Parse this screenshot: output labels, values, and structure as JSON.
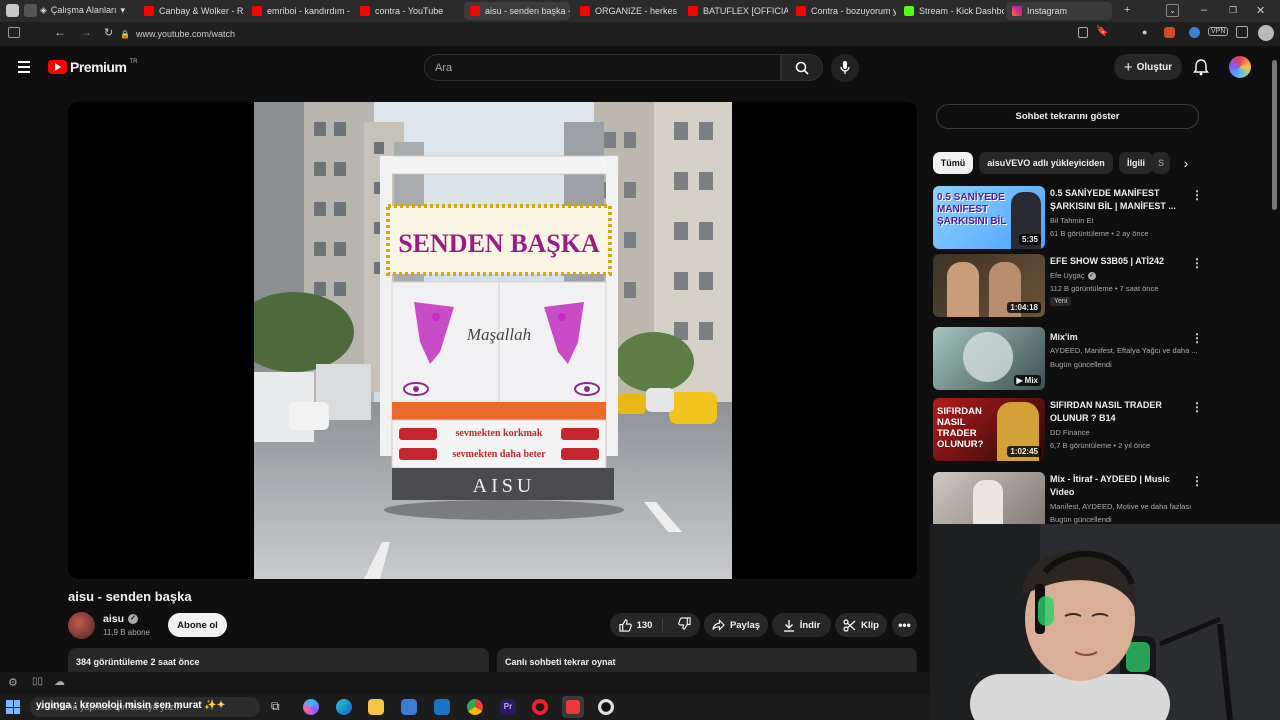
{
  "browser": {
    "workspaces_label": "Çalışma Alanları",
    "tabs": [
      {
        "title": "Canbay & Wolker - Rüs",
        "favicon": "youtube-icon"
      },
      {
        "title": "emriboi - kandırdım - Yo",
        "favicon": "youtube-icon"
      },
      {
        "title": "contra - YouTube",
        "favicon": "youtube-icon"
      },
      {
        "title": "aisu - senden başka - Yo",
        "favicon": "youtube-icon"
      },
      {
        "title": "ORGANIZE - herkes ken",
        "favicon": "youtube-icon"
      },
      {
        "title": "BATUFLEX [OFFICIAL VI",
        "favicon": "youtube-icon"
      },
      {
        "title": "Contra - bozuyorum ye",
        "favicon": "youtube-icon"
      },
      {
        "title": "Stream - Kick Dashboar",
        "favicon": "kick-icon"
      },
      {
        "title": "Instagram",
        "favicon": "instagram-icon"
      }
    ],
    "url": "www.youtube.com/watch",
    "vpn_label": "VPN"
  },
  "youtube": {
    "logo_text": "Premium",
    "logo_superscript": "TR",
    "search_placeholder": "Ara",
    "create_label": "Oluştur"
  },
  "video": {
    "title": "aisu - senden başka",
    "channel_name": "aisu",
    "subscribers": "11,9 B abone",
    "subscribe_label": "Abone ol",
    "like_count": "130",
    "share_label": "Paylaş",
    "download_label": "İndir",
    "clip_label": "Klip",
    "views_and_time": "384 görüntüleme  2 saat önce",
    "chat_replay_label": "Canlı sohbeti tekrar oynat",
    "artwork": {
      "sign_text": "SENDEN BAŞKA",
      "truck_script": "Maşallah",
      "line1": "sevmekten korkmak",
      "line2": "sevmekten daha beter",
      "plate": "AISU"
    }
  },
  "sidebar": {
    "chat_button": "Sohbet tekrarını göster",
    "chips": [
      "Tümü",
      "aisuVEVO adlı yükleyiciden",
      "İlgili",
      "S"
    ],
    "recommendations": [
      {
        "title": "0.5 SANİYEDE MANİFEST ŞARKISINI BİL | MANİFEST ...",
        "channel": "Bil Tahmin Et",
        "meta": "61 B görüntüleme • 2 ay önce",
        "duration": "5:35",
        "thumb_text": "0.5 SANİYEDE MANİFEST ŞARKISINI BİL"
      },
      {
        "title": "EFE SHOW S3B05 | ATİ242",
        "channel": "Efe Uygaç",
        "meta": "112 B görüntüleme • 7 saat önce",
        "duration": "1:04:18",
        "badge": "Yeni"
      },
      {
        "title": "Mix'im",
        "channel": "AYDEED, Manifest, Eftalya Yağcı ve daha ...",
        "meta": "Bugün güncellendi",
        "duration": "Mix"
      },
      {
        "title": "SIFIRDAN NASIL TRADER OLUNUR ? B14",
        "channel": "DD Finance",
        "meta": "6,7 B görüntüleme • 2 yıl önce",
        "duration": "1:02:45",
        "thumb_text": "SIFIRDAN NASIL TRADER OLUNUR?"
      },
      {
        "title": "Mix - İtiraf - AYDEED | Music Video",
        "channel": "Manifest, AYDEED, Motive ve daha fazlası",
        "meta": "Bugün güncellendi"
      }
    ]
  },
  "taskbar": {
    "search_text": "Arama yapmak için buraya yazın",
    "ticker_text": "yiginga : kronoloji misin sen murat"
  }
}
